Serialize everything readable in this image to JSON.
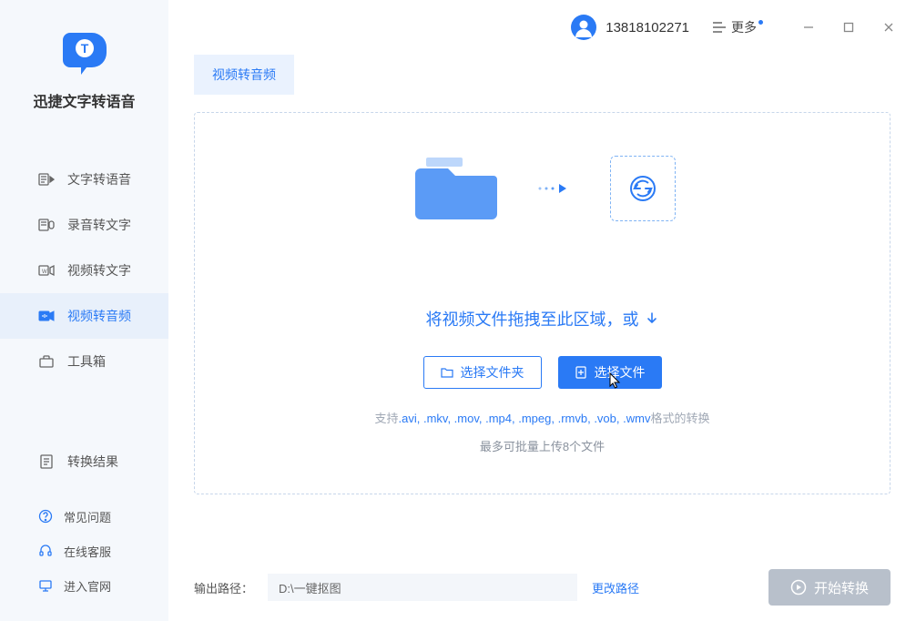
{
  "app": {
    "name": "迅捷文字转语音"
  },
  "sidebar": {
    "items": [
      {
        "label": "文字转语音"
      },
      {
        "label": "录音转文字"
      },
      {
        "label": "视频转文字"
      },
      {
        "label": "视频转音频"
      },
      {
        "label": "工具箱"
      }
    ],
    "results_label": "转换结果",
    "bottom": [
      {
        "label": "常见问题"
      },
      {
        "label": "在线客服"
      },
      {
        "label": "进入官网"
      }
    ]
  },
  "header": {
    "user_id": "13818102271",
    "more_label": "更多"
  },
  "tabs": [
    {
      "label": "视频转音频"
    }
  ],
  "dropzone": {
    "hint_text": "将视频文件拖拽至此区域，或",
    "select_folder": "选择文件夹",
    "select_file": "选择文件",
    "formats_prefix": "支持",
    "formats_list": ".avi, .mkv, .mov, .mp4, .mpeg, .rmvb, .vob, .wmv",
    "formats_suffix": "格式的转换",
    "limit_text": "最多可批量上传8个文件"
  },
  "footer": {
    "out_label": "输出路径：",
    "out_path": "D:\\一键抠图",
    "change_path": "更改路径",
    "start_label": "开始转换"
  }
}
